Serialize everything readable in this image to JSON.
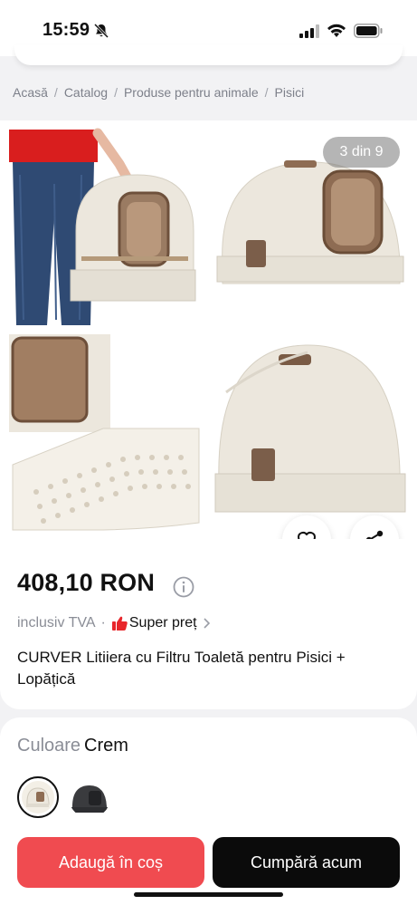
{
  "status": {
    "time": "15:59"
  },
  "breadcrumb": [
    "Acasă",
    "Catalog",
    "Produse pentru animale",
    "Pisici"
  ],
  "breadcrumb_sep": "/",
  "gallery": {
    "counter": "3 din 9"
  },
  "product": {
    "price": "408,10 RON",
    "vat": "inclusiv TVA",
    "dot": "·",
    "badge": "Super preț",
    "title": "CURVER Litiiera cu Filtru Toaletă pentru Pisici + Lopățică"
  },
  "color": {
    "label": "Culoare",
    "value": "Crem"
  },
  "actions": {
    "add_to_cart": "Adaugă în coș",
    "buy_now": "Cumpără acum"
  },
  "colors": {
    "accent": "#f04b50",
    "dark": "#0b0b0b",
    "product": "#ece7dd"
  }
}
